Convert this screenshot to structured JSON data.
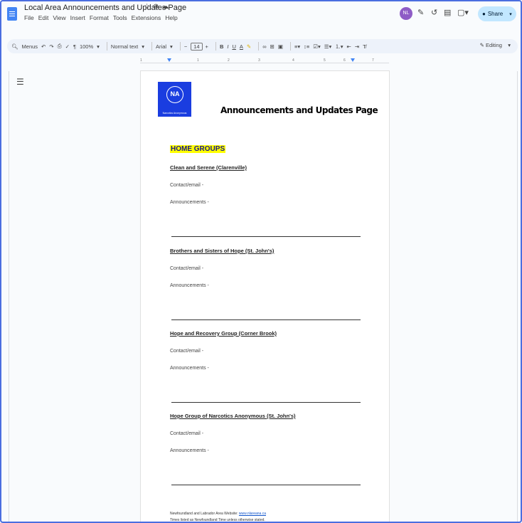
{
  "titlebar": {
    "doc_title": "Local Area Announcements and Updates Page",
    "menu": [
      "File",
      "Edit",
      "View",
      "Insert",
      "Format",
      "Tools",
      "Extensions",
      "Help"
    ],
    "avatar_initials": "NL",
    "share_label": "Share"
  },
  "toolbar": {
    "search_label": "Menus",
    "zoom": "100%",
    "style": "Normal text",
    "font": "Arial",
    "font_size": "14",
    "mode": "Editing"
  },
  "ruler": {
    "ticks": [
      "1",
      "1",
      "2",
      "3",
      "4",
      "5",
      "6",
      "7"
    ]
  },
  "document": {
    "heading": "Announcements and Updates Page",
    "logo": {
      "initials": "NA",
      "caption": "Narcotics Anonymous"
    },
    "section_title": "HOME GROUPS",
    "contact_label": "Contact/email -",
    "announcements_label": "Announcements -",
    "groups": [
      {
        "name": "Clean and Serene (Clarenville)"
      },
      {
        "name": "Brothers and Sisters of Hope (St. John's)"
      },
      {
        "name": "Hope and Recovery Group (Corner Brook)"
      },
      {
        "name": "Hope Group of Narcotics Anonymous (St. John's)"
      }
    ],
    "footer_prefix": "Newfoundland and Labrador Area Website:",
    "footer_link": "www.nlareana.ca",
    "footer_note": "Times listed as Newfoundland Time unless otherwise stated."
  },
  "colors": {
    "accent": "#4285f4",
    "share_bg": "#c2e7ff",
    "highlight": "#ffff00",
    "logo_bg": "#1a3de0"
  }
}
